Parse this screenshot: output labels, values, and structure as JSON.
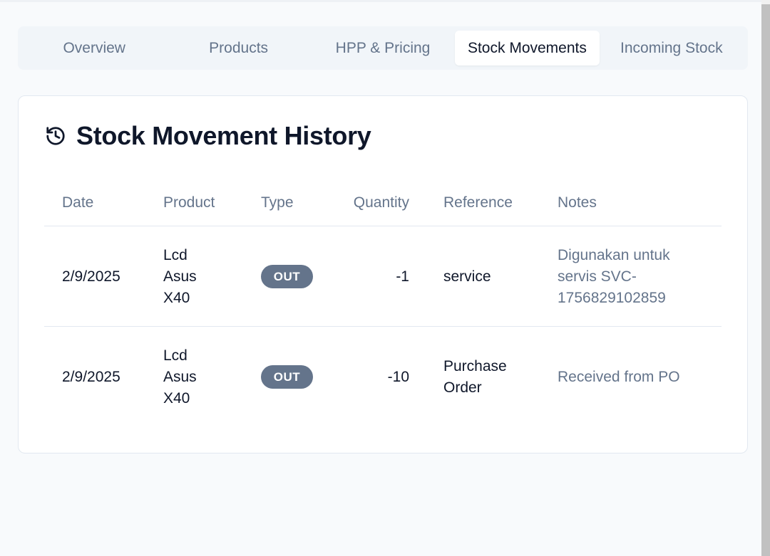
{
  "tabs": [
    {
      "label": "Overview"
    },
    {
      "label": "Products"
    },
    {
      "label": "HPP & Pricing"
    },
    {
      "label": "Stock Movements"
    },
    {
      "label": "Incoming Stock"
    }
  ],
  "active_tab": "Stock Movements",
  "card": {
    "title": "Stock Movement History",
    "icon": "history-icon"
  },
  "table": {
    "columns": [
      "Date",
      "Product",
      "Type",
      "Quantity",
      "Reference",
      "Notes"
    ],
    "rows": [
      {
        "date": "2/9/2025",
        "product_lines": [
          "Lcd",
          "Asus",
          "X40"
        ],
        "type": "OUT",
        "quantity": "-1",
        "reference_lines": [
          "service"
        ],
        "notes_lines": [
          "Digunakan untuk",
          "servis SVC-",
          "1756829102859"
        ]
      },
      {
        "date": "2/9/2025",
        "product_lines": [
          "Lcd",
          "Asus",
          "X40"
        ],
        "type": "OUT",
        "quantity": "-10",
        "reference_lines": [
          "Purchase",
          "Order"
        ],
        "notes_lines": [
          "Received from PO"
        ]
      }
    ]
  },
  "colors": {
    "badge_out": "#64748b",
    "muted_text": "#64748b",
    "border": "#e2e8f0",
    "background": "#f8fafc"
  }
}
